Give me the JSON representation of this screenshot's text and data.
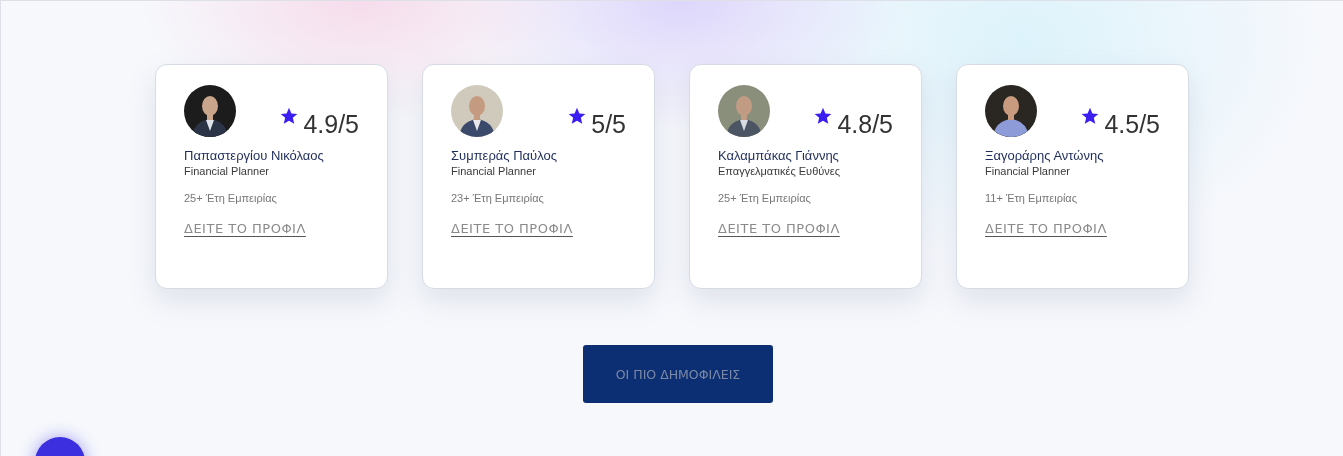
{
  "advisors": [
    {
      "name": "Παπαστεργίου Νικόλαος",
      "role": "Financial Planner",
      "rating": "4.9/5",
      "experience": "25+ Έτη Εμπειρίας",
      "link": "ΔΕΙΤΕ ΤΟ ΠΡΟΦΙΛ"
    },
    {
      "name": "Συμπεράς Παύλος",
      "role": "Financial Planner",
      "rating": "5/5",
      "experience": "23+ Έτη Εμπειρίας",
      "link": "ΔΕΙΤΕ ΤΟ ΠΡΟΦΙΛ"
    },
    {
      "name": "Καλαμπάκας Γιάννης",
      "role": "Επαγγελματικές Ευθύνες",
      "rating": "4.8/5",
      "experience": "25+ Έτη Εμπειρίας",
      "link": "ΔΕΙΤΕ ΤΟ ΠΡΟΦΙΛ"
    },
    {
      "name": "Ξαγοράρης Αντώνης",
      "role": "Financial Planner",
      "rating": "4.5/5",
      "experience": "11+ Έτη Εμπειρίας",
      "link": "ΔΕΙΤΕ ΤΟ ΠΡΟΦΙΛ"
    }
  ],
  "popular_button": "ΟΙ ΠΙΟ ΔΗΜΟΦΙΛΕΙΣ"
}
